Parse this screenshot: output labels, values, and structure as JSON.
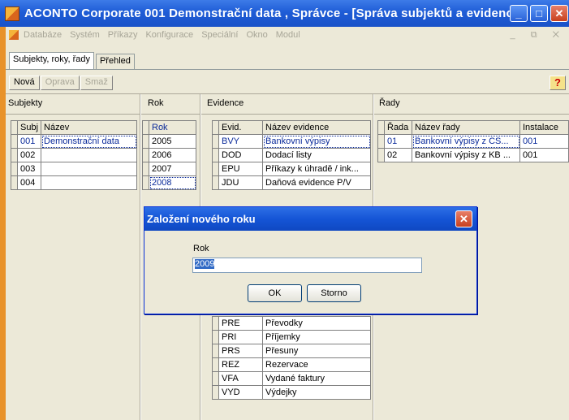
{
  "window": {
    "title": "ACONTO Corporate 001 Demonstrační data , Správce - [Správa subjektů a evidencí]",
    "minimize": "_",
    "restore": "□",
    "close": "✕"
  },
  "menu": {
    "items": [
      "Databáze",
      "Systém",
      "Příkazy",
      "Konfigurace",
      "Speciální",
      "Okno",
      "Modul"
    ],
    "right": "_ ⧉ ✕"
  },
  "tabs": [
    {
      "label": "Subjekty, roky, řady"
    },
    {
      "label": "Přehled"
    }
  ],
  "toolbar": {
    "new_label": "Nová",
    "new_key": "N",
    "edit_label": "Oprava",
    "delete_label": "Smaž",
    "help": "?"
  },
  "panes": {
    "subjekty": "Subjekty",
    "rok": "Rok",
    "evidence": "Evidence",
    "rady": "Řady"
  },
  "subjekty": {
    "headers": [
      "Subj",
      "Název"
    ],
    "rows": [
      [
        "001",
        "Demonstrační data"
      ],
      [
        "002",
        ""
      ],
      [
        "003",
        ""
      ],
      [
        "004",
        ""
      ]
    ]
  },
  "roky": {
    "header": "Rok",
    "rows": [
      "2005",
      "2006",
      "2007",
      "2008"
    ]
  },
  "evidence": {
    "headers": [
      "Evid.",
      "Název evidence"
    ],
    "rows_top": [
      [
        "BVY",
        "Bankovní výpisy"
      ],
      [
        "DOD",
        "Dodací listy"
      ],
      [
        "EPU",
        "Příkazy k úhradě / ink..."
      ],
      [
        "JDU",
        "Daňová evidence P/V"
      ]
    ],
    "rows_bottom": [
      [
        "PRE",
        "Převodky"
      ],
      [
        "PRI",
        "Příjemky"
      ],
      [
        "PRS",
        "Přesuny"
      ],
      [
        "REZ",
        "Rezervace"
      ],
      [
        "VFA",
        "Vydané faktury"
      ],
      [
        "VYD",
        "Výdejky"
      ]
    ]
  },
  "rady": {
    "headers": [
      "Řada",
      "Název řady",
      "Instalace"
    ],
    "rows": [
      [
        "01",
        "Bankovní výpisy z CS...",
        "001"
      ],
      [
        "02",
        "Bankovní výpisy z KB ...",
        "001"
      ]
    ]
  },
  "dialog": {
    "title": "Založení nového roku",
    "close": "✕",
    "label": "Rok",
    "value": "2009",
    "ok": "OK",
    "cancel": "Storno"
  }
}
